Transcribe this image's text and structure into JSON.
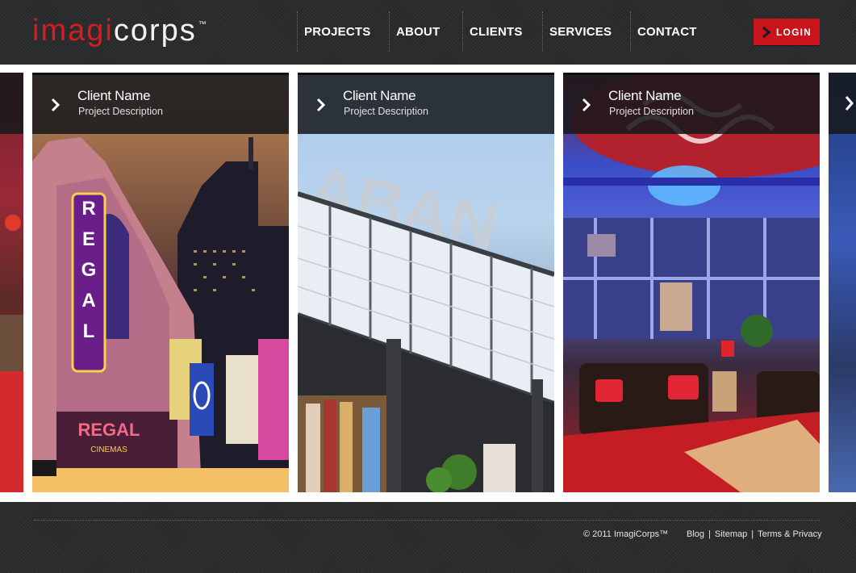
{
  "brand": {
    "logo_part1": "imagi",
    "logo_part2": "corps",
    "trademark": "™"
  },
  "nav": {
    "items": [
      {
        "label": "PROJECTS"
      },
      {
        "label": "ABOUT"
      },
      {
        "label": "CLIENTS"
      },
      {
        "label": "SERVICES"
      },
      {
        "label": "CONTACT"
      }
    ]
  },
  "login": {
    "label": "LOGIN",
    "icon": "chevron-right-icon"
  },
  "carousel": {
    "panels": [
      {
        "client": "Client Name",
        "description": "Project Description",
        "icon": "chevron-right-icon"
      },
      {
        "client": "Client Name",
        "description": "Project Description",
        "icon": "chevron-right-icon"
      },
      {
        "client": "Client Name",
        "description": "Project Description",
        "icon": "chevron-right-icon"
      }
    ],
    "signage": {
      "regal": "REGAL",
      "regal_cinema": "REGAL",
      "cinemas": "CINEMAS",
      "aban": "ABAN"
    }
  },
  "footer": {
    "copyright": "© 2011 ImagiCorps™",
    "links": [
      {
        "label": "Blog"
      },
      {
        "label": "Sitemap"
      },
      {
        "label": "Terms & Privacy"
      }
    ],
    "separator": "|"
  },
  "colors": {
    "brand_red": "#d51d22",
    "login_red": "#c8141b",
    "bar_dark": "#2c2d2f"
  }
}
